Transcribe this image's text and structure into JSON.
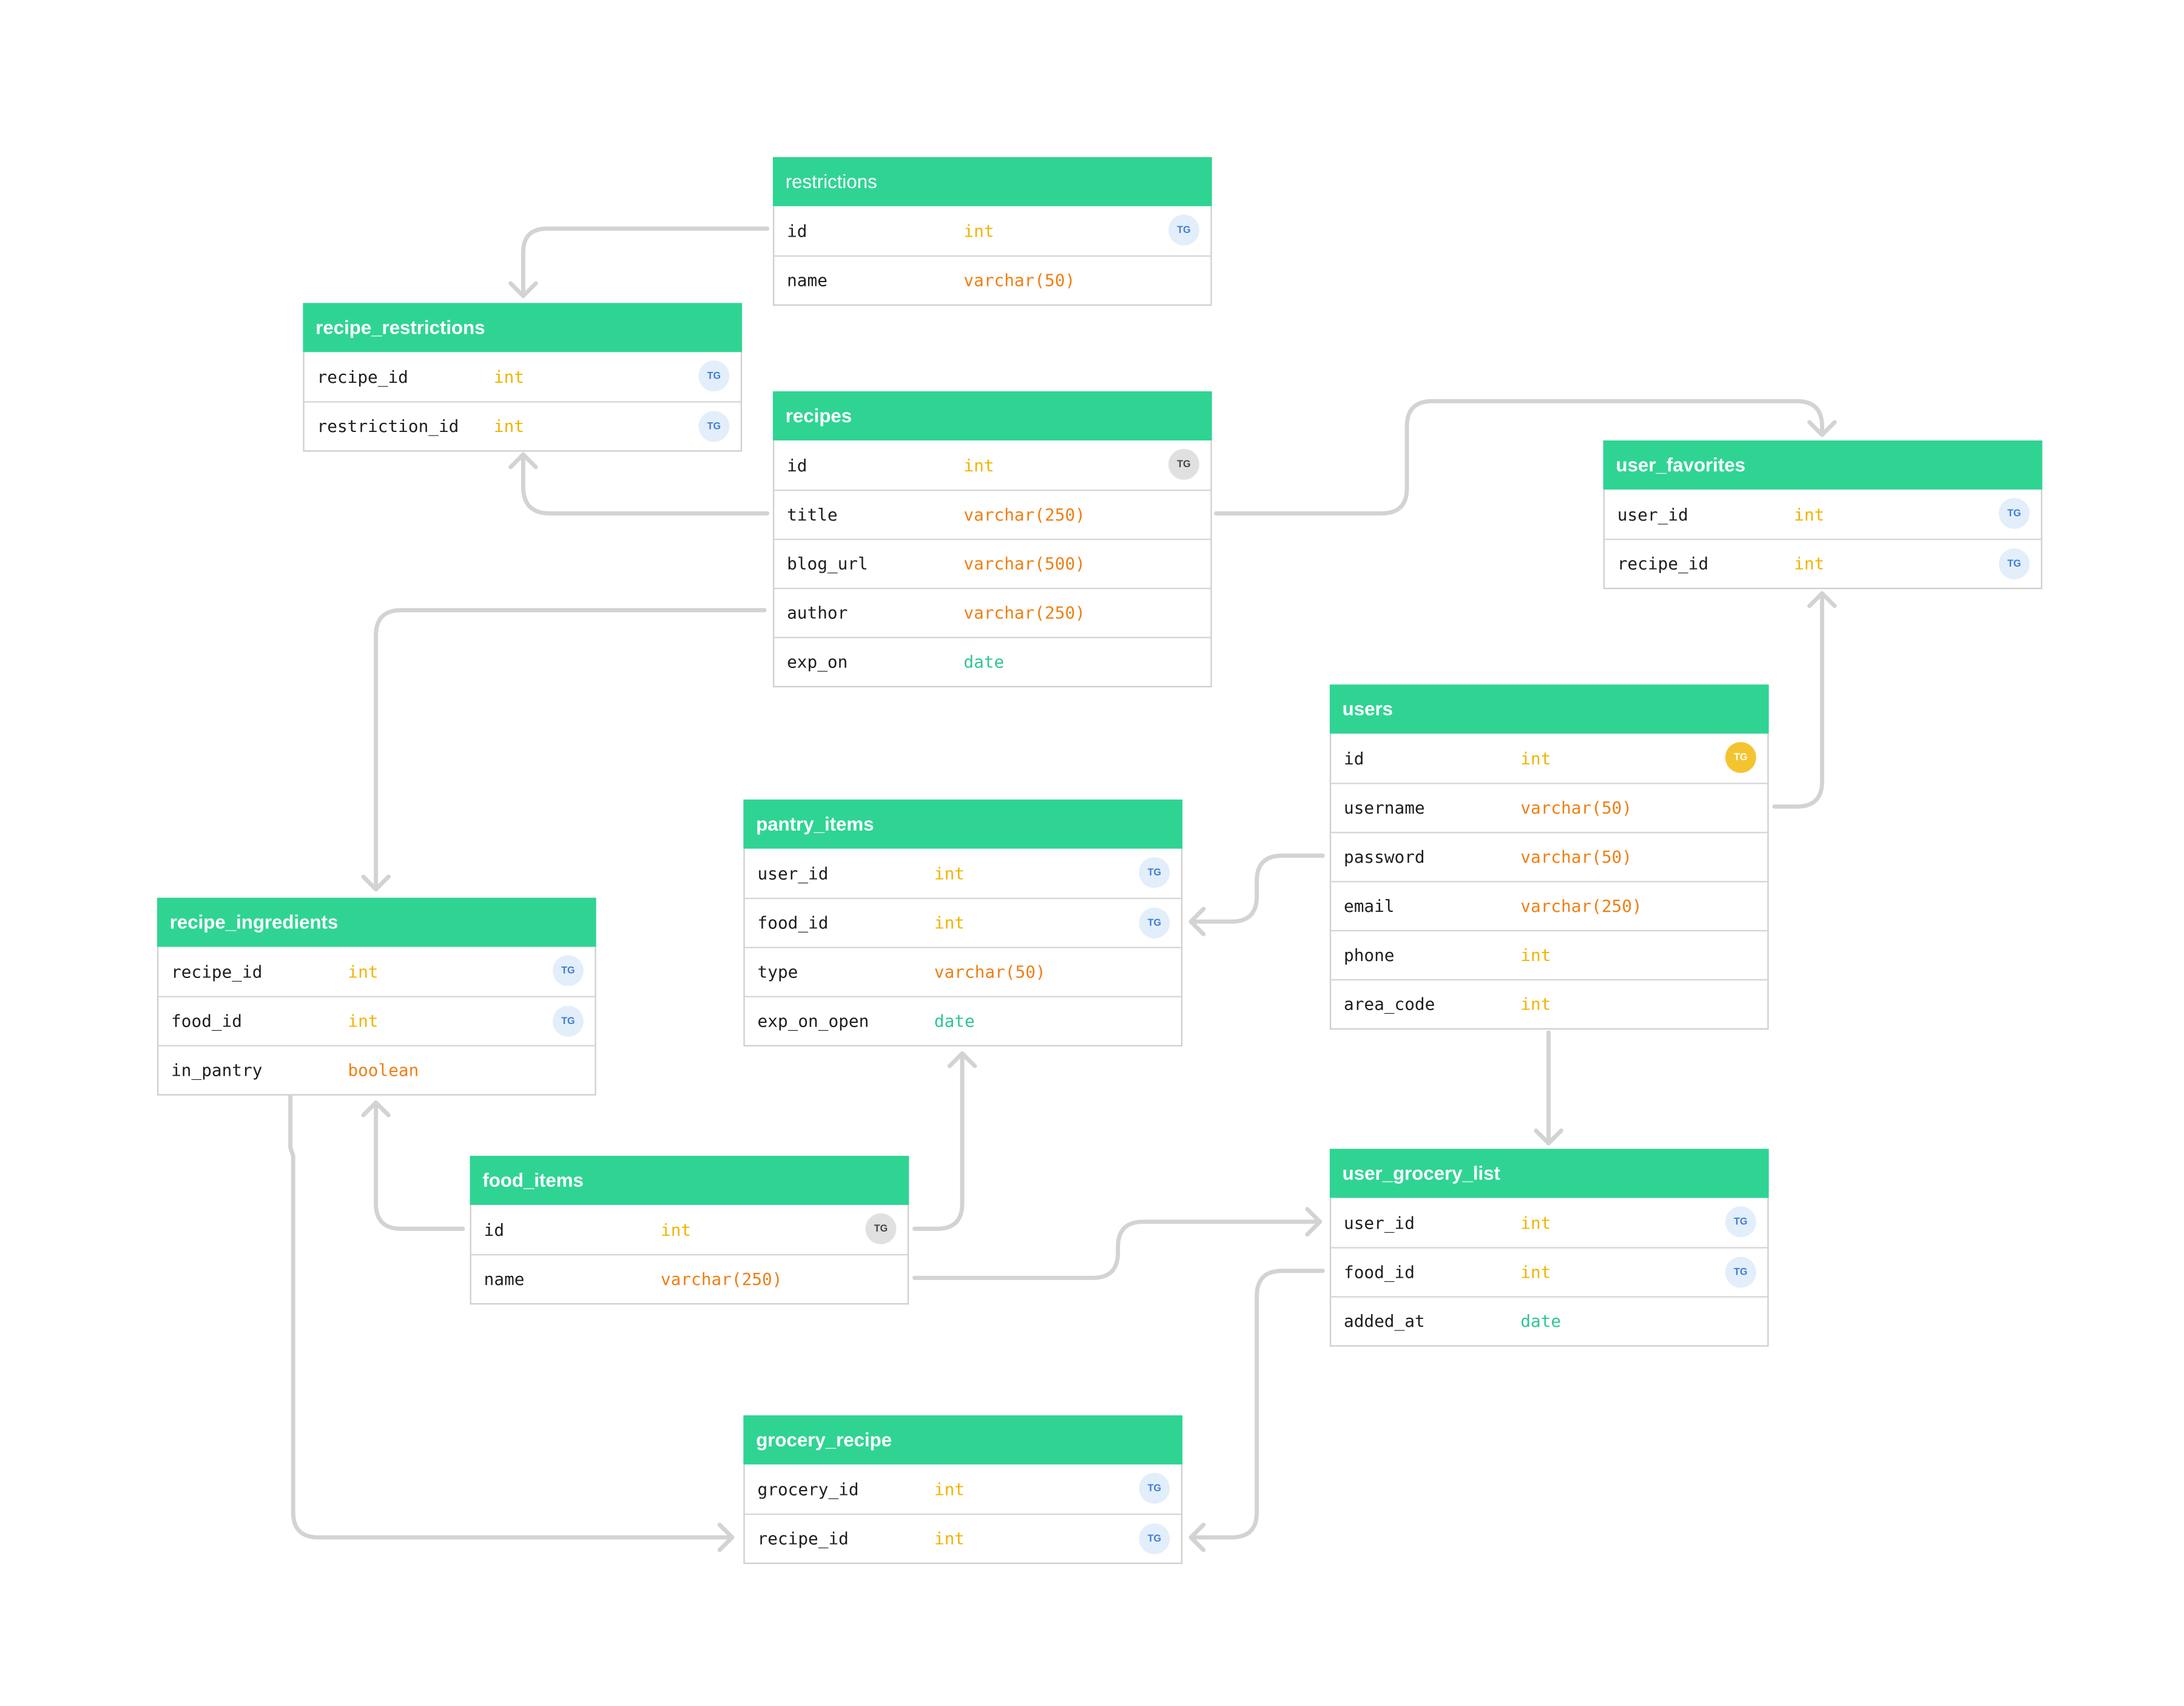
{
  "tables": [
    {
      "id": "restrictions",
      "name": "restrictions",
      "light": true,
      "columns": [
        {
          "name": "id",
          "type": "int",
          "type_class": "t-int",
          "badge": "TG",
          "badge_style": "blue"
        },
        {
          "name": "name",
          "type": "varchar(50)",
          "type_class": "t-varchar",
          "badge": "",
          "badge_style": ""
        }
      ]
    },
    {
      "id": "recipe_restrictions",
      "name": "recipe_restrictions",
      "light": false,
      "columns": [
        {
          "name": "recipe_id",
          "type": "int",
          "type_class": "t-int",
          "badge": "TG",
          "badge_style": "blue"
        },
        {
          "name": "restriction_id",
          "type": "int",
          "type_class": "t-int",
          "badge": "TG",
          "badge_style": "blue"
        }
      ]
    },
    {
      "id": "recipes",
      "name": "recipes",
      "light": false,
      "columns": [
        {
          "name": "id",
          "type": "int",
          "type_class": "t-int",
          "badge": "TG",
          "badge_style": "gray"
        },
        {
          "name": "title",
          "type": "varchar(250)",
          "type_class": "t-varchar",
          "badge": "",
          "badge_style": ""
        },
        {
          "name": "blog_url",
          "type": "varchar(500)",
          "type_class": "t-varchar",
          "badge": "",
          "badge_style": ""
        },
        {
          "name": "author",
          "type": "varchar(250)",
          "type_class": "t-varchar",
          "badge": "",
          "badge_style": ""
        },
        {
          "name": "exp_on",
          "type": "date",
          "type_class": "t-date",
          "badge": "",
          "badge_style": ""
        }
      ]
    },
    {
      "id": "user_favorites",
      "name": "user_favorites",
      "light": false,
      "columns": [
        {
          "name": "user_id",
          "type": "int",
          "type_class": "t-int",
          "badge": "TG",
          "badge_style": "blue"
        },
        {
          "name": "recipe_id",
          "type": "int",
          "type_class": "t-int",
          "badge": "TG",
          "badge_style": "blue"
        }
      ]
    },
    {
      "id": "users",
      "name": "users",
      "light": false,
      "columns": [
        {
          "name": "id",
          "type": "int",
          "type_class": "t-int",
          "badge": "TG",
          "badge_style": "gold"
        },
        {
          "name": "username",
          "type": "varchar(50)",
          "type_class": "t-varchar",
          "badge": "",
          "badge_style": ""
        },
        {
          "name": "password",
          "type": "varchar(50)",
          "type_class": "t-varchar",
          "badge": "",
          "badge_style": ""
        },
        {
          "name": "email",
          "type": "varchar(250)",
          "type_class": "t-varchar",
          "badge": "",
          "badge_style": ""
        },
        {
          "name": "phone",
          "type": "int",
          "type_class": "t-int",
          "badge": "",
          "badge_style": ""
        },
        {
          "name": "area_code",
          "type": "int",
          "type_class": "t-int",
          "badge": "",
          "badge_style": ""
        }
      ]
    },
    {
      "id": "pantry_items",
      "name": "pantry_items",
      "light": false,
      "columns": [
        {
          "name": "user_id",
          "type": "int",
          "type_class": "t-int",
          "badge": "TG",
          "badge_style": "blue"
        },
        {
          "name": "food_id",
          "type": "int",
          "type_class": "t-int",
          "badge": "TG",
          "badge_style": "blue"
        },
        {
          "name": "type",
          "type": "varchar(50)",
          "type_class": "t-varchar",
          "badge": "",
          "badge_style": ""
        },
        {
          "name": "exp_on_open",
          "type": "date",
          "type_class": "t-date",
          "badge": "",
          "badge_style": ""
        }
      ]
    },
    {
      "id": "recipe_ingredients",
      "name": "recipe_ingredients",
      "light": false,
      "columns": [
        {
          "name": "recipe_id",
          "type": "int",
          "type_class": "t-int",
          "badge": "TG",
          "badge_style": "blue"
        },
        {
          "name": "food_id",
          "type": "int",
          "type_class": "t-int",
          "badge": "TG",
          "badge_style": "blue"
        },
        {
          "name": "in_pantry",
          "type": "boolean",
          "type_class": "t-boolean",
          "badge": "",
          "badge_style": ""
        }
      ]
    },
    {
      "id": "food_items",
      "name": "food_items",
      "light": false,
      "columns": [
        {
          "name": "id",
          "type": "int",
          "type_class": "t-int",
          "badge": "TG",
          "badge_style": "gray"
        },
        {
          "name": "name",
          "type": "varchar(250)",
          "type_class": "t-varchar",
          "badge": "",
          "badge_style": ""
        }
      ]
    },
    {
      "id": "user_grocery_list",
      "name": "user_grocery_list",
      "light": false,
      "columns": [
        {
          "name": "user_id",
          "type": "int",
          "type_class": "t-int",
          "badge": "TG",
          "badge_style": "blue"
        },
        {
          "name": "food_id",
          "type": "int",
          "type_class": "t-int",
          "badge": "TG",
          "badge_style": "blue"
        },
        {
          "name": "added_at",
          "type": "date",
          "type_class": "t-date",
          "badge": "",
          "badge_style": ""
        }
      ]
    },
    {
      "id": "grocery_recipe",
      "name": "grocery_recipe",
      "light": false,
      "columns": [
        {
          "name": "grocery_id",
          "type": "int",
          "type_class": "t-int",
          "badge": "TG",
          "badge_style": "blue"
        },
        {
          "name": "recipe_id",
          "type": "int",
          "type_class": "t-int",
          "badge": "TG",
          "badge_style": "blue"
        }
      ]
    }
  ],
  "colors": {
    "header": "#2fd493",
    "connector": "#d3d3d3"
  }
}
